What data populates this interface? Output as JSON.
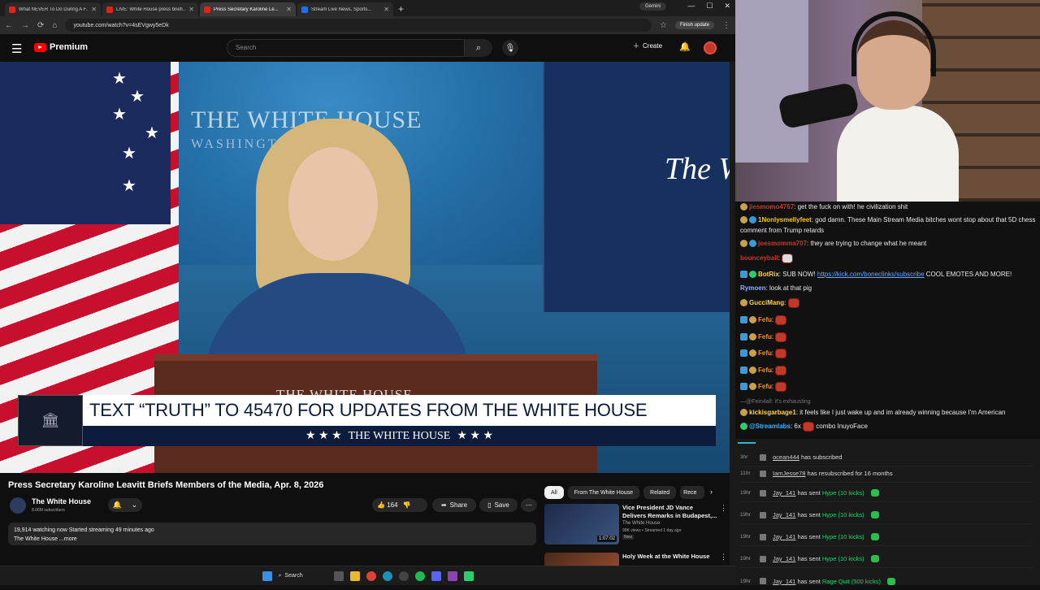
{
  "browser": {
    "tabs": [
      {
        "title": "What NEVER To Do During A F...",
        "favicon": "youtube"
      },
      {
        "title": "LIVE: White House press briefi...",
        "favicon": "youtube"
      },
      {
        "title": "Press Secretary Karoline Le...",
        "favicon": "youtube",
        "active": true
      },
      {
        "title": "Stream Live News, Sports...",
        "favicon": "web"
      }
    ],
    "new_tab": "+",
    "gemini": "Gemini",
    "url": "youtube.com/watch?v=4sEVgwy5eDk",
    "finish_update": "Finish update"
  },
  "youtube": {
    "logo": "Premium",
    "search_placeholder": "Search",
    "create": "Create"
  },
  "video": {
    "seal_line1": "THE WHITE HOUSE",
    "seal_line2": "WASHINGTON",
    "monitor_text": "The W",
    "podium_text": "THE WHITE HOUSE",
    "chyron_text": "TEXT “TRUTH” TO 45470 FOR UPDATES FROM THE WHITE HOUSE",
    "chyron_sub": "THE WHITE HOUSE",
    "title": "Press Secretary Karoline Leavitt Briefs Members of the Media, Apr. 8, 2026",
    "channel": "The White House",
    "subscribers": "8.06M subscribers",
    "likes": "164",
    "share": "Share",
    "save": "Save",
    "watching": "19,914 watching now  Started streaming 49 minutes ago",
    "desc_line2": "The White House ...more"
  },
  "sidebar": {
    "chips": [
      "All",
      "From The White House",
      "Related",
      "Rece"
    ],
    "recs": [
      {
        "title": "Vice President JD Vance Delivers Remarks in Budapest,...",
        "channel": "The White House",
        "views": "99K views • Streamed 1 day ago",
        "badge": "New",
        "duration": "1:07:02"
      },
      {
        "title": "Holy Week at the White House",
        "channel": "",
        "views": "",
        "badge": "",
        "duration": ""
      }
    ]
  },
  "taskbar": {
    "search": "Search"
  },
  "chat": {
    "messages": [
      {
        "user": "jiesmomo4767",
        "text": "get the fuck on with! he civilization shit",
        "color": "#c0392b"
      },
      {
        "user": "1Nonlysmellyfeet",
        "text": "god damn. These Main Stream Media bitches wont stop about that 5D chess comment from Trump retards",
        "color": "#f1c40f"
      },
      {
        "user": "joesmomma707",
        "text": "they are trying to change what he meant",
        "color": "#c0392b"
      },
      {
        "user": "bounceyball",
        "text": "",
        "color": "#c0392b"
      },
      {
        "user": "BotRix",
        "text": "SUB NOW! ",
        "link": "https://kick.com/boneclinks/subscribe",
        "text2": " COOL EMOTES AND MORE!",
        "color": "#ffd23f"
      },
      {
        "user": "Rymoen",
        "text": "look at that pig",
        "color": "#8ab4ff"
      },
      {
        "user": "GucciMang",
        "text": "",
        "color": "#ffd23f"
      },
      {
        "user": "Fefu",
        "text": "",
        "color": "#ff8c1a"
      },
      {
        "user": "Fefu",
        "text": "",
        "color": "#ff8c1a"
      },
      {
        "user": "Fefu",
        "text": "",
        "color": "#ff8c1a"
      },
      {
        "user": "Fefu",
        "text": "",
        "color": "#ff8c1a"
      },
      {
        "user": "Fefu",
        "text": "",
        "color": "#ff8c1a"
      },
      {
        "user": "@Fein4all",
        "text": "it's exhausting",
        "color": "#777777"
      },
      {
        "user": "kickisgarbage1",
        "text": "it feels like I just wake up and im already winning because I'm American",
        "color": "#ffd23f"
      },
      {
        "user": "@Streamlabs",
        "text": "6x",
        "text2": " combo InuyoFace",
        "color": "#3ab0ff"
      }
    ]
  },
  "events": [
    {
      "time": "3hr",
      "user": "ocean444",
      "text": " has subscribed",
      "hl": ""
    },
    {
      "time": "11hr",
      "user": "IamJesse78",
      "text": " has resubscribed for 16 months",
      "hl": ""
    },
    {
      "time": "19hr",
      "user": "Jay_141",
      "text": " has sent ",
      "hl": "Hype (10 kicks)"
    },
    {
      "time": "19hr",
      "user": "Jay_141",
      "text": " has sent ",
      "hl": "Hype (10 kicks)"
    },
    {
      "time": "19hr",
      "user": "Jay_141",
      "text": " has sent ",
      "hl": "Hype (10 kicks)"
    },
    {
      "time": "19hr",
      "user": "Jay_141",
      "text": " has sent ",
      "hl": "Hype (10 kicks)"
    },
    {
      "time": "19hr",
      "user": "Jay_141",
      "text": " has sent ",
      "hl": "Rage Quit (500 kicks)"
    }
  ]
}
